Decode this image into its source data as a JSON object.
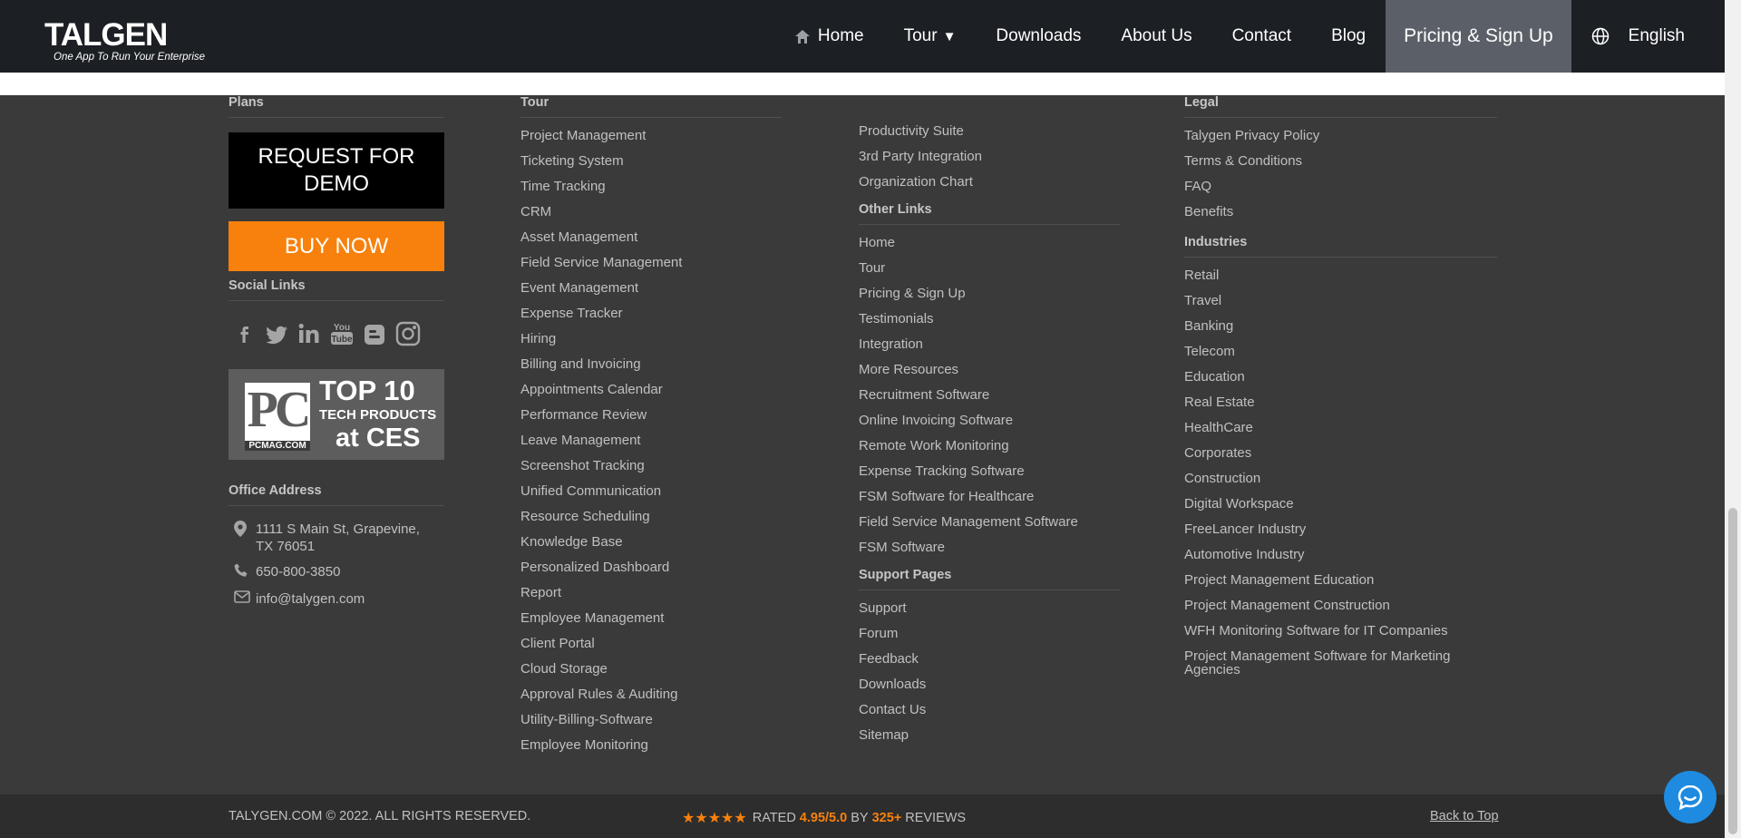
{
  "header": {
    "logo_name": "TALGEN",
    "logo_tagline": "One App To Run Your Enterprise",
    "nav": {
      "home": "Home",
      "tour": "Tour",
      "downloads": "Downloads",
      "about": "About Us",
      "contact": "Contact",
      "blog": "Blog",
      "pricing": "Pricing & Sign Up",
      "language": "English"
    }
  },
  "plans": {
    "heading": "Plans",
    "demo_button": "REQUEST FOR DEMO",
    "buy_button": "BUY NOW",
    "social_heading": "Social Links",
    "social_icons": [
      "facebook-icon",
      "twitter-icon",
      "linkedin-icon",
      "youtube-icon",
      "blogger-icon",
      "instagram-icon"
    ],
    "award": {
      "logo": "PC",
      "logo_sub": "PCMAG.COM",
      "line1": "TOP 10",
      "line2": "TECH PRODUCTS",
      "line3": "at CES"
    },
    "office_heading": "Office Address",
    "address": "1111 S Main St, Grapevine, TX 76051",
    "phone": "650-800-3850",
    "email": "info@talygen.com"
  },
  "tour": {
    "heading": "Tour",
    "links": [
      "Project Management",
      "Ticketing System",
      "Time Tracking",
      "CRM",
      "Asset Management",
      "Field Service Management",
      "Event Management",
      "Expense Tracker",
      "Hiring",
      "Billing and Invoicing",
      "Appointments Calendar",
      "Performance Review",
      "Leave Management",
      "Screenshot Tracking",
      "Unified Communication",
      "Resource Scheduling",
      "Knowledge Base",
      "Personalized Dashboard",
      "Report",
      "Employee Management",
      "Client Portal",
      "Cloud Storage",
      "Approval Rules & Auditing",
      "Utility-Billing-Software",
      "Employee Monitoring"
    ]
  },
  "tour_cont": {
    "links": [
      "Productivity Suite",
      "3rd Party Integration",
      "Organization Chart"
    ]
  },
  "other_links": {
    "heading": "Other Links",
    "links": [
      "Home",
      "Tour",
      "Pricing & Sign Up",
      "Testimonials",
      "Integration",
      "More Resources",
      "Recruitment Software",
      "Online Invoicing Software",
      "Remote Work Monitoring",
      "Expense Tracking Software",
      "FSM Software for Healthcare",
      "Field Service Management Software",
      "FSM Software"
    ]
  },
  "support": {
    "heading": "Support Pages",
    "links": [
      "Support",
      "Forum",
      "Feedback",
      "Downloads",
      "Contact Us",
      "Sitemap"
    ]
  },
  "legal": {
    "heading": "Legal",
    "links": [
      "Talygen Privacy Policy",
      "Terms & Conditions",
      "FAQ",
      "Benefits"
    ]
  },
  "industries": {
    "heading": "Industries",
    "links": [
      "Retail",
      "Travel",
      "Banking",
      "Telecom",
      "Education",
      "Real Estate",
      "HealthCare",
      "Corporates",
      "Construction",
      "Digital Workspace",
      "FreeLancer Industry",
      "Automotive Industry",
      "Project Management Education",
      "Project Management Construction",
      "WFH Monitoring Software for IT Companies",
      "Project Management Software for Marketing Agencies"
    ]
  },
  "bottom": {
    "copyright": "TALYGEN.COM © 2022. ALL RIGHTS RESERVED.",
    "stars": "★★★★★",
    "rated_label": "RATED",
    "rating": "4.95/5.0",
    "by_label": "BY",
    "reviews_count": "325+",
    "reviews_label": "REVIEWS",
    "back_to_top": "Back to Top"
  },
  "colors": {
    "accent": "#f7810c",
    "header_bg": "#1c1f24",
    "footer_bg": "#3a3a3a",
    "chat": "#1e8be0"
  }
}
